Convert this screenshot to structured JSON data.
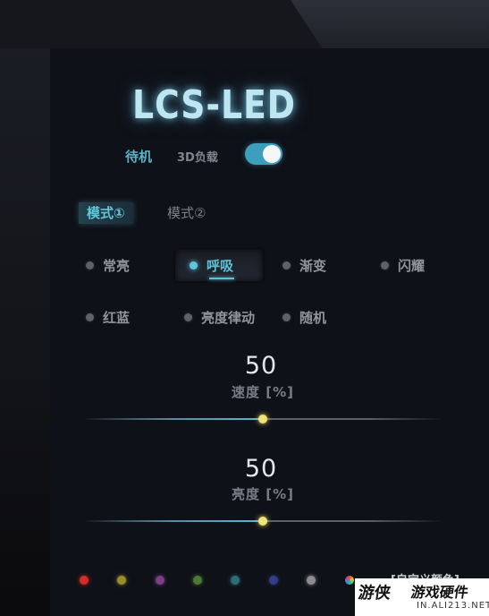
{
  "header": {
    "logo": "LCS-LED"
  },
  "power": {
    "standby_label": "待机",
    "load3d_label": "3D负载",
    "toggle_on": true
  },
  "tabs": [
    {
      "label": "模式①",
      "active": true
    },
    {
      "label": "模式②",
      "active": false
    }
  ],
  "modes": [
    {
      "label": "常亮",
      "active": false
    },
    {
      "label": "呼吸",
      "active": true
    },
    {
      "label": "渐变",
      "active": false
    },
    {
      "label": "闪耀",
      "active": false
    },
    {
      "label": "红蓝",
      "active": false
    },
    {
      "label": "亮度律动",
      "active": false
    },
    {
      "label": "随机",
      "active": false
    }
  ],
  "speed": {
    "value": "50",
    "label": "速度 [%]",
    "level": 50
  },
  "brightness": {
    "value": "50",
    "label": "亮度 [%]",
    "level": 50
  },
  "colors": {
    "swatches": [
      "#d32a2a",
      "#9a8d2a",
      "#7b3f86",
      "#4e7a36",
      "#2f6d74",
      "#343c86",
      "#8d8d8d",
      "rainbow"
    ],
    "custom_label": "[自定义颜色]"
  },
  "watermark": {
    "brand": "游侠",
    "product": "游戏硬件",
    "site": "IN.ALI213.NET"
  },
  "theme": {
    "accent": "#5fc1d8",
    "thumb": "#f2e27a",
    "background": "#0f1118"
  }
}
